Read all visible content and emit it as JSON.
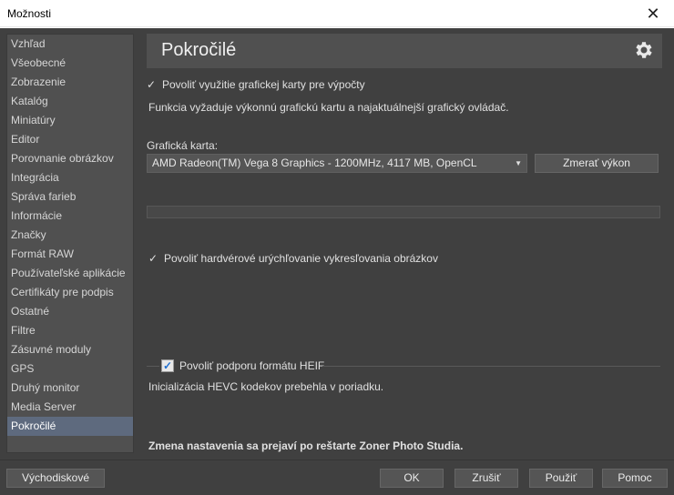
{
  "window": {
    "title": "Možnosti",
    "close_glyph": "✕"
  },
  "sidebar": {
    "items": [
      {
        "label": "Vzhľad"
      },
      {
        "label": "Všeobecné"
      },
      {
        "label": "Zobrazenie"
      },
      {
        "label": "Katalóg"
      },
      {
        "label": "Miniatúry"
      },
      {
        "label": "Editor"
      },
      {
        "label": "Porovnanie obrázkov"
      },
      {
        "label": "Integrácia"
      },
      {
        "label": "Správa farieb"
      },
      {
        "label": "Informácie"
      },
      {
        "label": "Značky"
      },
      {
        "label": "Formát RAW"
      },
      {
        "label": "Používateľské aplikácie"
      },
      {
        "label": "Certifikáty pre podpis"
      },
      {
        "label": "Ostatné"
      },
      {
        "label": "Filtre"
      },
      {
        "label": "Zásuvné moduly"
      },
      {
        "label": "GPS"
      },
      {
        "label": "Druhý monitor"
      },
      {
        "label": "Media Server"
      },
      {
        "label": "Pokročilé"
      }
    ],
    "selected": "Pokročilé"
  },
  "main": {
    "title": "Pokročilé",
    "gear_icon": "gear-icon",
    "gpu_compute": {
      "label": "Povoliť využitie grafickej karty pre výpočty",
      "checked": true,
      "note": "Funkcia vyžaduje výkonnú grafickú kartu a najaktuálnejší grafický ovládač."
    },
    "graphics_card": {
      "label": "Grafická karta:",
      "value": "AMD Radeon(TM) Vega 8 Graphics - 1200MHz, 4117 MB, OpenCL",
      "measure_button": "Zmerať výkon"
    },
    "hw_accel": {
      "label": "Povoliť hardvérové urýchľovanie vykresľovania obrázkov",
      "checked": true
    },
    "heif": {
      "label": "Povoliť podporu formátu HEIF",
      "checked": true,
      "status": "Inicializácia HEVC kodekov prebehla v poriadku."
    },
    "restart_note": "Zmena nastavenia sa prejaví po reštarte Zoner Photo Studia."
  },
  "footer": {
    "defaults": "Východiskové",
    "ok": "OK",
    "cancel": "Zrušiť",
    "apply": "Použiť",
    "help": "Pomoc"
  },
  "colors": {
    "background": "#404040",
    "panel": "#505050",
    "selected": "#5e6a7e",
    "text": "#e0e0e0"
  }
}
